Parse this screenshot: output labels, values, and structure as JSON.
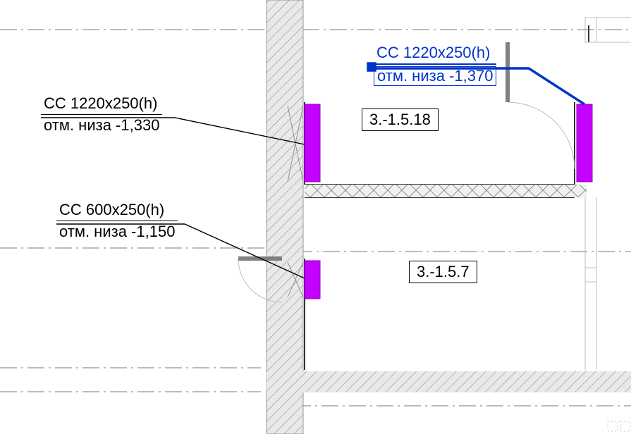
{
  "annotations": {
    "a1": {
      "line1": "CC 1220x250(h)",
      "line2": "отм. низа -1,370"
    },
    "a2": {
      "line1": "CC 1220x250(h)",
      "line2": "отм. низа -1,330"
    },
    "a3": {
      "line1": "CC 600x250(h)",
      "line2": "отм. низа -1,150"
    }
  },
  "rooms": {
    "r1": "3.-1.5.18",
    "r2": "3.-1.5.7"
  },
  "colors": {
    "opening_fill": "#c400ff",
    "selection": "#0033cc",
    "wall_body": "#d9d9d9",
    "wall_hatch": "#808080",
    "grid": "#7a7a7a"
  }
}
